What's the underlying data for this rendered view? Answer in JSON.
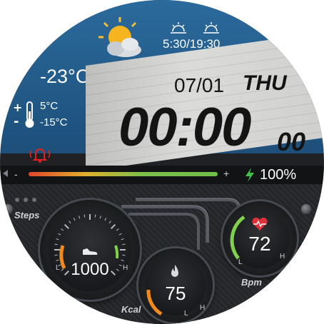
{
  "weather": {
    "icon": "partly-cloudy-icon",
    "current_temp": "-23°C",
    "high_temp": "5°C",
    "low_temp": "-15°C",
    "sunrise_sunset": "5:30/19:30"
  },
  "date": {
    "day_month": "07/01",
    "weekday": "THU"
  },
  "time": {
    "hours_minutes": "00:00",
    "seconds": "00"
  },
  "battery": {
    "percent_label": "100%",
    "level": 1.0
  },
  "steps": {
    "label": "Steps",
    "value": "1000",
    "low": "L",
    "high": "H"
  },
  "heart": {
    "label": "Bpm",
    "value": "72",
    "low": "L",
    "high": "H"
  },
  "calories": {
    "label": "Kcal",
    "value": "75",
    "low": "L",
    "high": "H"
  },
  "colors": {
    "sky": "#235b89",
    "alarm": "#e02020",
    "battery_bolt": "#3ec24a",
    "heart": "#e0303a",
    "gauge_green": "#7fd04a",
    "gauge_orange": "#f08a1e"
  }
}
